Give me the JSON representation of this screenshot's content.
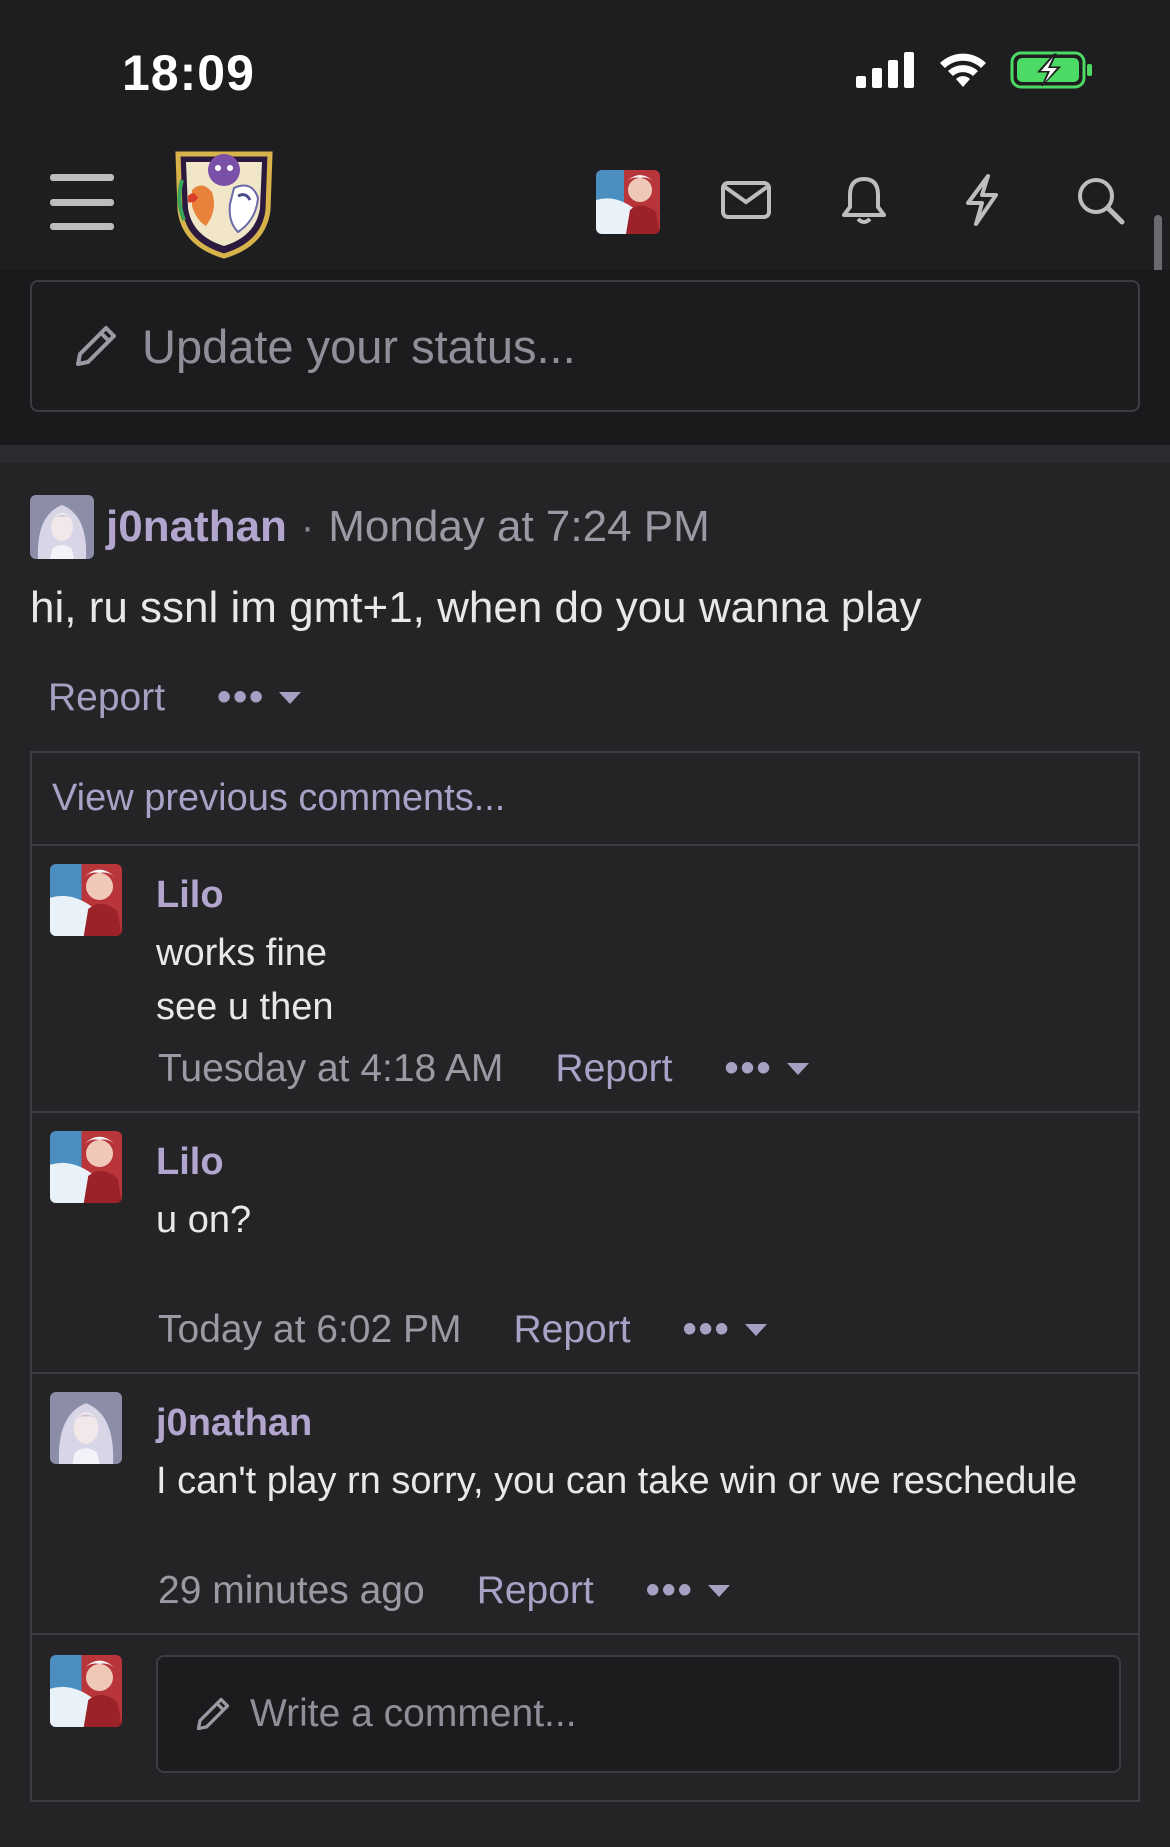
{
  "status_bar": {
    "time": "18:09",
    "icons": [
      "signal-icon",
      "wifi-icon",
      "battery-charging-icon"
    ]
  },
  "header": {
    "icons": [
      "menu-icon",
      "site-logo",
      "user-avatar",
      "mail-icon",
      "bell-icon",
      "lightning-icon",
      "search-icon"
    ]
  },
  "status_update": {
    "placeholder": "Update your status..."
  },
  "post": {
    "author": "j0nathan",
    "separator": "·",
    "time": "Monday at 7:24 PM",
    "body": "hi, ru ssnl im gmt+1, when do you wanna play",
    "report_label": "Report",
    "more_label": "•••"
  },
  "comments": {
    "view_previous": "View previous comments...",
    "items": [
      {
        "author": "Lilo",
        "line1": "works fine",
        "line2": "see u then",
        "time": "Tuesday at 4:18 AM",
        "report": "Report",
        "more": "•••"
      },
      {
        "author": "Lilo",
        "line1": "u on?",
        "time": "Today at 6:02 PM",
        "report": "Report",
        "more": "•••"
      },
      {
        "author": "j0nathan",
        "line1": "I can't play rn sorry, you can take win or we reschedule",
        "time": "29 minutes ago",
        "report": "Report",
        "more": "•••"
      }
    ],
    "write_placeholder": "Write a comment..."
  },
  "colors": {
    "background": "#1d1d20",
    "username": "#b2a6cf",
    "link": "#a9a1c6",
    "battery": "#4cd964"
  }
}
